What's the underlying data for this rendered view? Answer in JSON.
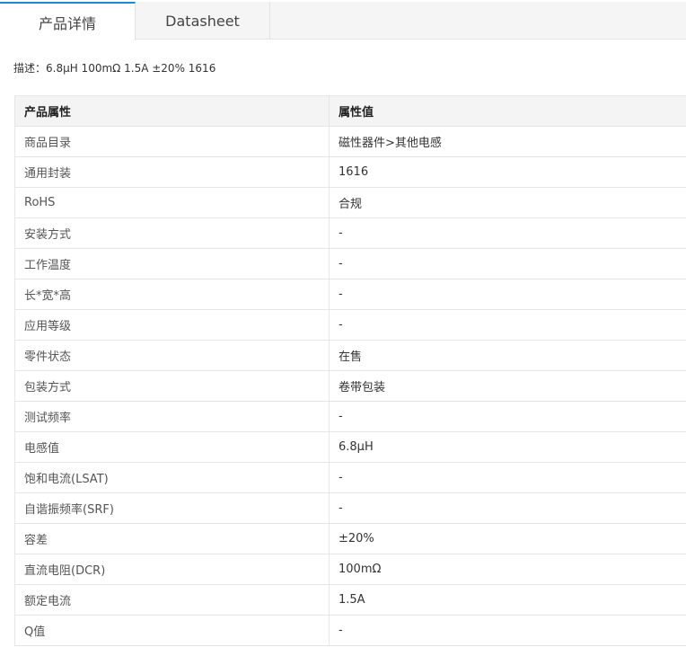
{
  "tabs": [
    {
      "label": "产品详情",
      "active": true
    },
    {
      "label": "Datasheet",
      "active": false
    }
  ],
  "description": "描述：6.8μH 100mΩ 1.5A ±20% 1616",
  "table": {
    "headers": [
      "产品属性",
      "属性值"
    ],
    "rows": [
      {
        "attribute": "商品目录",
        "value": "磁性器件>其他电感"
      },
      {
        "attribute": "通用封装",
        "value": "1616"
      },
      {
        "attribute": "RoHS",
        "value": "合规"
      },
      {
        "attribute": "安装方式",
        "value": "-"
      },
      {
        "attribute": "工作温度",
        "value": "-"
      },
      {
        "attribute": "长*宽*高",
        "value": "-"
      },
      {
        "attribute": "应用等级",
        "value": "-"
      },
      {
        "attribute": "零件状态",
        "value": "在售"
      },
      {
        "attribute": "包装方式",
        "value": "卷带包装"
      },
      {
        "attribute": "测试频率",
        "value": "-"
      },
      {
        "attribute": "电感值",
        "value": "6.8μH"
      },
      {
        "attribute": "饱和电流(LSAT)",
        "value": "-"
      },
      {
        "attribute": "自谐振频率(SRF)",
        "value": "-"
      },
      {
        "attribute": "容差",
        "value": "±20%"
      },
      {
        "attribute": "直流电阻(DCR)",
        "value": "100mΩ"
      },
      {
        "attribute": "额定电流",
        "value": "1.5A"
      },
      {
        "attribute": "Q值",
        "value": "-"
      }
    ]
  },
  "colors": {
    "accent": "#1a8ad3",
    "tabbar_bg": "#f5f5f5",
    "header_bg": "#f4f4f4",
    "border": "#e6e6e6"
  }
}
